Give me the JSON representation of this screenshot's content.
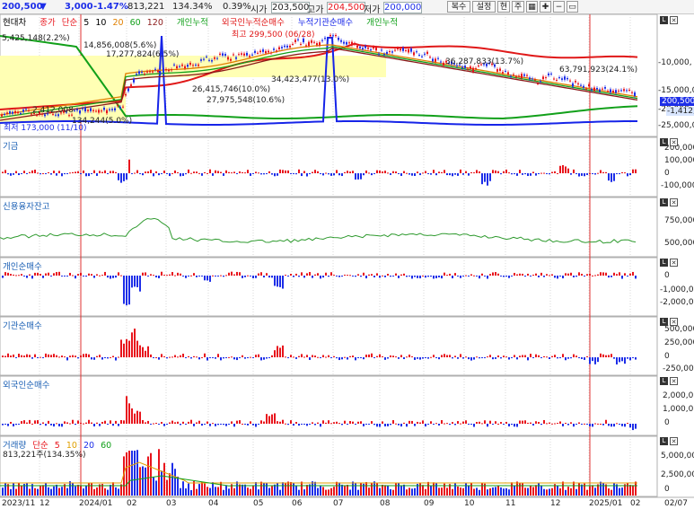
{
  "toolbar": {
    "price": "200,500",
    "arrow": "▼",
    "change": "3,000",
    "change_pct": "-1.47%",
    "volume": "813,221",
    "volume_ratio": "134.34%",
    "turnover": "0.39%",
    "open_label": "시가",
    "open_value": "203,500",
    "high_label": "고가",
    "high_value": "204,500",
    "low_label": "저가",
    "low_value": "200,000",
    "buttons": [
      "복수",
      "설정",
      "현",
      "주"
    ]
  },
  "main_legend": {
    "stock_name": "현대차",
    "price_label": "종가",
    "ma_label": "단순",
    "ma_periods": [
      "5",
      "10",
      "20",
      "60",
      "120"
    ],
    "indicators": [
      "개인누적",
      "외국인누적순매수",
      "누적기관순매수",
      "개인누적"
    ]
  },
  "main_annotations": {
    "max_price": "최고 299,500 (06/28)",
    "min_price": "최저 173,000 (11/10)",
    "a1": "5,425,148(2.2%)",
    "a2": "14,856,008(5.6%)",
    "a3": "17,277,824(6.5%)",
    "a4": "2,412,008",
    "a5": "134,244(5.0%)",
    "a6": "26,415,746(10.0%)",
    "a7": "34,423,477(13.0%)",
    "a8": "27,975,548(10.6%)",
    "a9": "36,287,833(13.7%)",
    "a10": "63,791,923(24.1%)"
  },
  "main_axis": [
    "-10,000,",
    "-15,000,0",
    "-20,000,",
    "-25,000,0"
  ],
  "current_price_tag": "200,500",
  "current_value_tag": "-1,412,8",
  "panels": {
    "gigeum": {
      "title": "기금",
      "ticks": [
        "200,000",
        "100,000",
        "0",
        "-100,000"
      ]
    },
    "credit": {
      "title": "신용융자잔고",
      "ticks": [
        "750,000",
        "500,000"
      ]
    },
    "individual": {
      "title": "개인순매수",
      "ticks": [
        "0",
        "-1,000,000",
        "-2,000,000"
      ]
    },
    "institution": {
      "title": "기관순매수",
      "ticks": [
        "500,000",
        "250,000",
        "0",
        "-250,000"
      ]
    },
    "foreign": {
      "title": "외국인순매수",
      "ticks": [
        "2,000,000",
        "1,000,000",
        "0"
      ]
    },
    "volume": {
      "title": "거래량",
      "ma_label": "단순",
      "ma_periods": [
        "5",
        "10",
        "20",
        "60"
      ],
      "current": "813,221주(134.35%)",
      "ticks": [
        "5,000,000",
        "2,500,000",
        "0"
      ]
    }
  },
  "x_axis": [
    "2023/11",
    "12",
    "2024/01",
    "02",
    "03",
    "04",
    "05",
    "06",
    "07",
    "08",
    "09",
    "10",
    "11",
    "12",
    "2025/01",
    "02",
    "02/07"
  ],
  "colors": {
    "up": "#e8141c",
    "down": "#1d2ee8",
    "grid": "#d9d9d9",
    "vline": "#e03030",
    "indicator_blue": "#1624e8",
    "indicator_green": "#12a01a",
    "indicator_red": "#e01818",
    "highlight": "#ffffb4"
  }
}
